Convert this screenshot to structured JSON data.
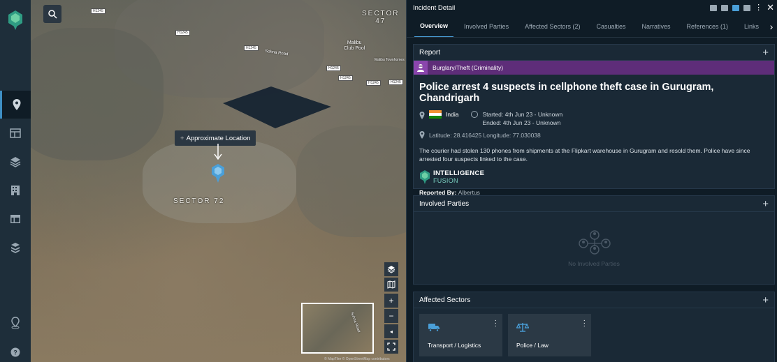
{
  "map": {
    "labels": {
      "sector_47": "SECTOR\n47",
      "sector_72": "SECTOR 72",
      "malibu": "Malibu\nClub Pool",
      "malibu_town": "Malibu Townhomes",
      "sohna_road": "Sohna Road",
      "sohna_road_mini": "Sohna Road"
    },
    "road_shields": [
      "H1245",
      "H1245",
      "H1245",
      "H1245",
      "H1245",
      "H1245",
      "H1245"
    ],
    "approximate_location": "Approximate Location",
    "attribution": "© MapTiler © OpenStreetMap contributors"
  },
  "panel": {
    "title": "Incident Detail",
    "tabs": [
      {
        "label": "Overview",
        "active": true
      },
      {
        "label": "Involved Parties"
      },
      {
        "label": "Affected Sectors (2)"
      },
      {
        "label": "Casualties"
      },
      {
        "label": "Narratives"
      },
      {
        "label": "References (1)"
      },
      {
        "label": "Links"
      }
    ],
    "report": {
      "section_title": "Report",
      "category": "Burglary/Theft (Criminality)",
      "category_color": "#5e2d79",
      "headline": "Police arrest 4 suspects in cellphone theft case in Gurugram, Chandrigarh",
      "country": "India",
      "started": "Started: 4th Jun 23 - Unknown",
      "ended": "Ended: 4th Jun 23 - Unknown",
      "latlon": "Latitude: 28.416425 Longitude: 77.030038",
      "description": "The courier had stolen 130 phones from shipments at the Flipkart warehouse in Gurugram and resold them. Police have since arrested four suspects linked to the case.",
      "brand_line1": "INTELLIGENCE",
      "brand_line2": "FUSION",
      "reported_by_label": "Reported By:",
      "reported_by": "Albertus"
    },
    "involved_parties": {
      "section_title": "Involved Parties",
      "empty_text": "No Involved Parties"
    },
    "affected_sectors": {
      "section_title": "Affected Sectors",
      "items": [
        {
          "label": "Transport / Logistics",
          "icon": "truck-icon"
        },
        {
          "label": "Police / Law",
          "icon": "scales-icon"
        }
      ]
    }
  },
  "colors": {
    "accent": "#4a9fd8",
    "nav_bg": "#1e2e3a",
    "panel_bg": "#0f1c26",
    "card_bg": "#1a2936"
  }
}
